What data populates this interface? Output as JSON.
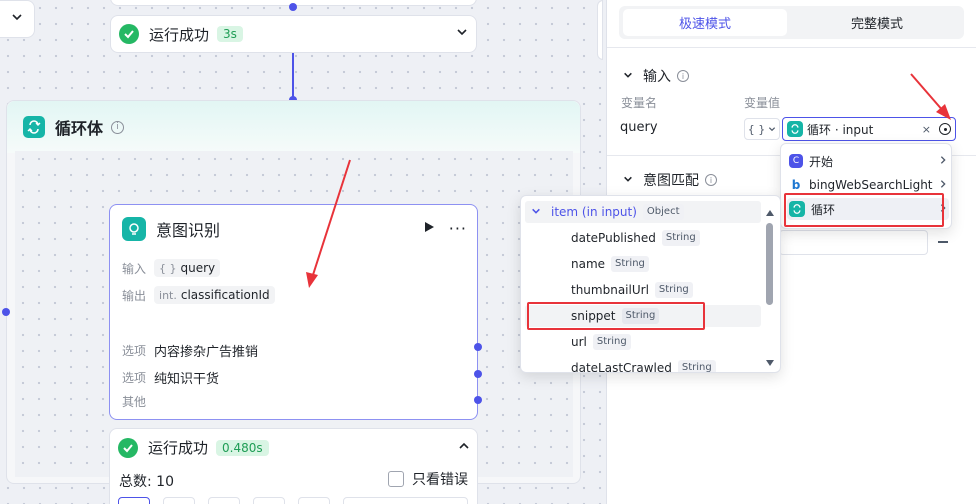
{
  "top_run": {
    "label": "运行成功",
    "time": "3s"
  },
  "loop": {
    "title": "循环体"
  },
  "intent_node": {
    "title": "意图识别",
    "input_label": "输入",
    "input_prefix": "{ }",
    "input_value": "query",
    "output_label": "输出",
    "output_prefix": "int.",
    "output_value": "classificationId",
    "options": [
      {
        "label": "选项",
        "value": "内容掺杂广告推销"
      },
      {
        "label": "选项",
        "value": "纯知识干货"
      },
      {
        "label": "其他",
        "value": ""
      }
    ]
  },
  "bottom_run": {
    "label": "运行成功",
    "time": "0.480s",
    "total": "总数: 10",
    "errors_only": "只看错误"
  },
  "dropdown": {
    "parent": {
      "name": "item (in input)",
      "type": "Object"
    },
    "items": [
      {
        "name": "datePublished",
        "type": "String"
      },
      {
        "name": "name",
        "type": "String"
      },
      {
        "name": "thumbnailUrl",
        "type": "String"
      },
      {
        "name": "snippet",
        "type": "String"
      },
      {
        "name": "url",
        "type": "String"
      },
      {
        "name": "dateLastCrawled",
        "type": "String"
      }
    ]
  },
  "panel": {
    "mode_fast": "极速模式",
    "mode_full": "完整模式",
    "input_section": "输入",
    "col_var_name": "变量名",
    "col_var_value": "变量值",
    "var_name": "query",
    "type_symbol": "{ }",
    "ref_value": "循环 · input",
    "intent_section": "意图匹配"
  },
  "var_menu": {
    "items": [
      {
        "label": "开始"
      },
      {
        "label": "bingWebSearchLight"
      },
      {
        "label": "循环"
      }
    ]
  },
  "colors": {
    "accent": "#4d53e8",
    "success": "#25b864",
    "teal": "#16b5a7",
    "annotation": "#e8333a"
  }
}
